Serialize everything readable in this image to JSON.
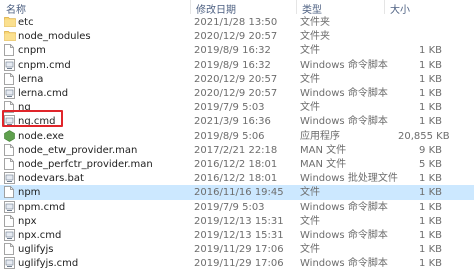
{
  "columns": {
    "name": "名称",
    "date": "修改日期",
    "type": "类型",
    "size": "大小"
  },
  "rows": [
    {
      "name": "etc",
      "date": "2021/1/28 13:50",
      "type": "文件夹",
      "size": "",
      "icon": "folder-icon",
      "kind": "folder"
    },
    {
      "name": "node_modules",
      "date": "2020/12/9 20:57",
      "type": "文件夹",
      "size": "",
      "icon": "folder-icon",
      "kind": "folder"
    },
    {
      "name": "cnpm",
      "date": "2019/8/9 16:32",
      "type": "文件",
      "size": "1 KB",
      "icon": "file-icon",
      "kind": "file"
    },
    {
      "name": "cnpm.cmd",
      "date": "2019/8/9 16:32",
      "type": "Windows 命令脚本",
      "size": "1 KB",
      "icon": "cmd-script-icon",
      "kind": "cmd"
    },
    {
      "name": "lerna",
      "date": "2020/12/9 20:57",
      "type": "文件",
      "size": "1 KB",
      "icon": "file-icon",
      "kind": "file"
    },
    {
      "name": "lerna.cmd",
      "date": "2020/12/9 20:57",
      "type": "Windows 命令脚本",
      "size": "1 KB",
      "icon": "cmd-script-icon",
      "kind": "cmd"
    },
    {
      "name": "ng",
      "date": "2019/7/9 5:03",
      "type": "文件",
      "size": "1 KB",
      "icon": "file-icon",
      "kind": "file"
    },
    {
      "name": "ng.cmd",
      "date": "2021/3/9 16:36",
      "type": "Windows 命令脚本",
      "size": "1 KB",
      "icon": "cmd-script-icon",
      "kind": "cmd"
    },
    {
      "name": "node.exe",
      "date": "2019/8/9 5:06",
      "type": "应用程序",
      "size": "20,855 KB",
      "icon": "nodejs-app-icon",
      "kind": "exe"
    },
    {
      "name": "node_etw_provider.man",
      "date": "2017/2/21 22:18",
      "type": "MAN 文件",
      "size": "9 KB",
      "icon": "file-icon",
      "kind": "file"
    },
    {
      "name": "node_perfctr_provider.man",
      "date": "2016/12/2 18:01",
      "type": "MAN 文件",
      "size": "5 KB",
      "icon": "file-icon",
      "kind": "file"
    },
    {
      "name": "nodevars.bat",
      "date": "2016/12/2 18:01",
      "type": "Windows 批处理文件",
      "size": "1 KB",
      "icon": "bat-script-icon",
      "kind": "cmd"
    },
    {
      "name": "npm",
      "date": "2016/11/16 19:45",
      "type": "文件",
      "size": "1 KB",
      "icon": "file-icon",
      "kind": "file",
      "selected": true
    },
    {
      "name": "npm.cmd",
      "date": "2019/7/9 5:03",
      "type": "Windows 命令脚本",
      "size": "1 KB",
      "icon": "cmd-script-icon",
      "kind": "cmd"
    },
    {
      "name": "npx",
      "date": "2019/12/13 15:31",
      "type": "文件",
      "size": "1 KB",
      "icon": "file-icon",
      "kind": "file"
    },
    {
      "name": "npx.cmd",
      "date": "2019/12/13 15:31",
      "type": "Windows 命令脚本",
      "size": "1 KB",
      "icon": "cmd-script-icon",
      "kind": "cmd"
    },
    {
      "name": "uglifyjs",
      "date": "2019/11/29 17:06",
      "type": "文件",
      "size": "1 KB",
      "icon": "file-icon",
      "kind": "file"
    },
    {
      "name": "uglifyjs.cmd",
      "date": "2019/11/29 17:06",
      "type": "Windows 命令脚本",
      "size": "1 KB",
      "icon": "cmd-script-icon",
      "kind": "cmd"
    }
  ],
  "annotation": {
    "highlighted_row": "ng.cmd",
    "color": "#e0252a"
  },
  "colors": {
    "selected_row": "#cce8ff",
    "folder": "#f8d775",
    "header_text": "#4d6082"
  }
}
